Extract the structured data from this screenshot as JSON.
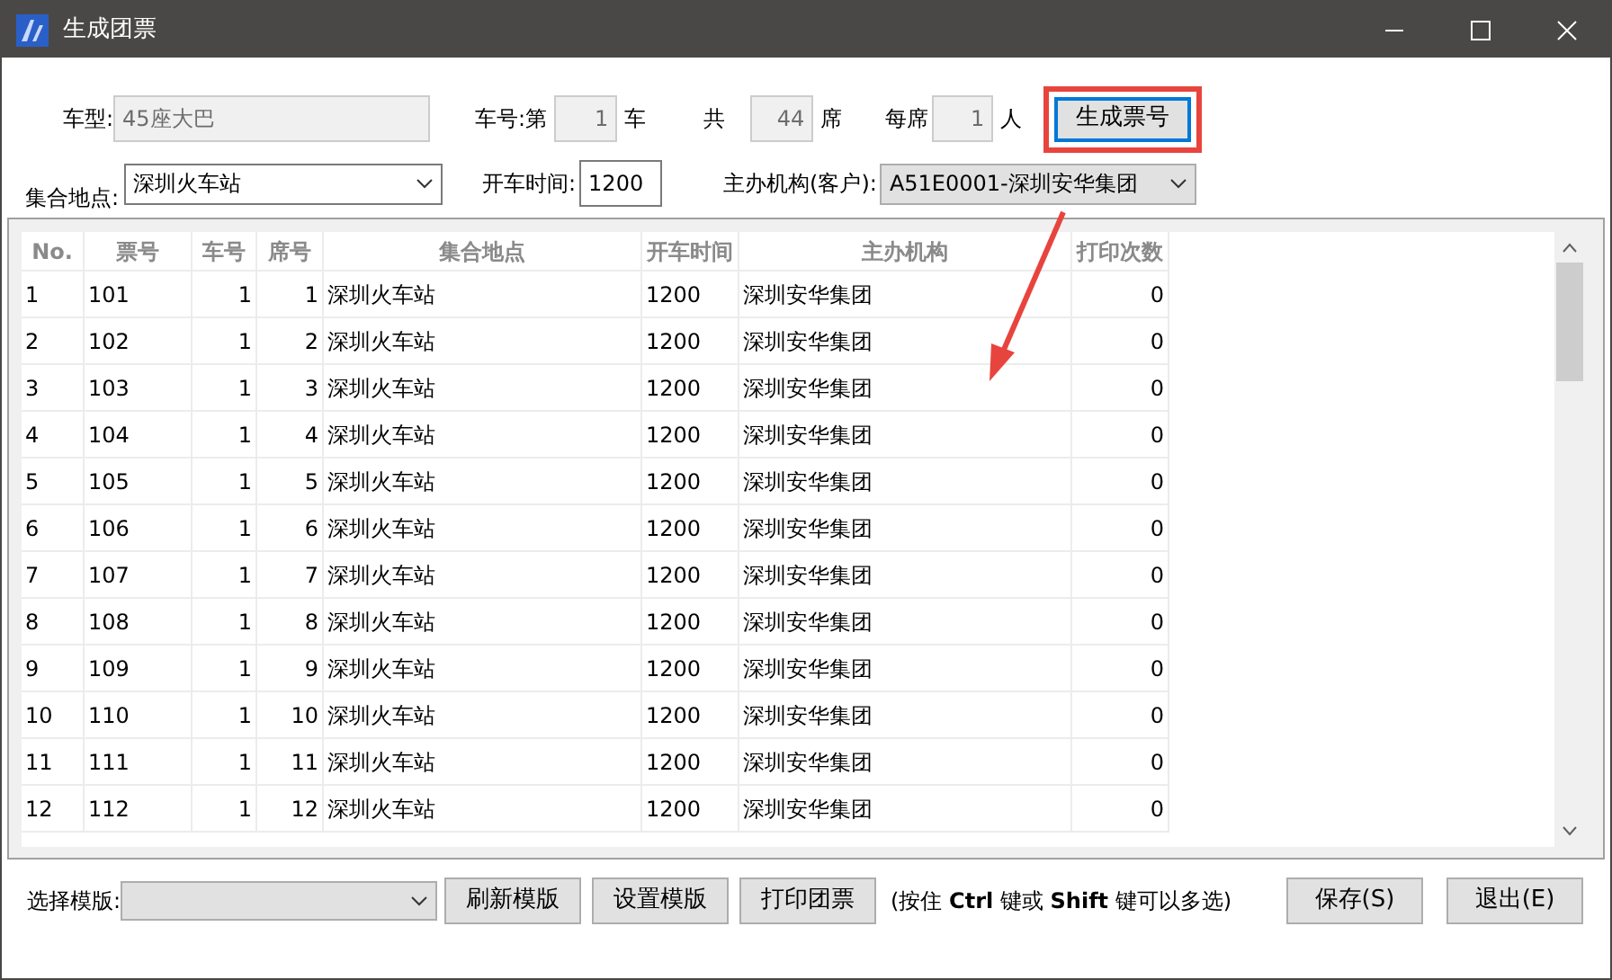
{
  "window": {
    "title": "生成团票"
  },
  "form": {
    "vehicle_type": {
      "label": "车型:",
      "value": "45座大巴"
    },
    "vehicle_no": {
      "label": "车号:第",
      "value": "1",
      "unit": "车"
    },
    "total": {
      "label": "共",
      "value": "44",
      "unit": "席"
    },
    "per_seat": {
      "label": "每席",
      "value": "1",
      "unit": "人"
    },
    "generate_button": "生成票号",
    "meeting_place": {
      "label": "集合地点:",
      "value": "深圳火车站"
    },
    "departure_time": {
      "label": "开车时间:",
      "value": "1200"
    },
    "organizer": {
      "label": "主办机构(客户):",
      "value": "A51E0001-深圳安华集团"
    }
  },
  "table": {
    "columns": [
      "No.",
      "票号",
      "车号",
      "席号",
      "集合地点",
      "开车时间",
      "主办机构",
      "打印次数"
    ],
    "rows": [
      [
        "1",
        "101",
        "1",
        "1",
        "深圳火车站",
        "1200",
        "深圳安华集团",
        "0"
      ],
      [
        "2",
        "102",
        "1",
        "2",
        "深圳火车站",
        "1200",
        "深圳安华集团",
        "0"
      ],
      [
        "3",
        "103",
        "1",
        "3",
        "深圳火车站",
        "1200",
        "深圳安华集团",
        "0"
      ],
      [
        "4",
        "104",
        "1",
        "4",
        "深圳火车站",
        "1200",
        "深圳安华集团",
        "0"
      ],
      [
        "5",
        "105",
        "1",
        "5",
        "深圳火车站",
        "1200",
        "深圳安华集团",
        "0"
      ],
      [
        "6",
        "106",
        "1",
        "6",
        "深圳火车站",
        "1200",
        "深圳安华集团",
        "0"
      ],
      [
        "7",
        "107",
        "1",
        "7",
        "深圳火车站",
        "1200",
        "深圳安华集团",
        "0"
      ],
      [
        "8",
        "108",
        "1",
        "8",
        "深圳火车站",
        "1200",
        "深圳安华集团",
        "0"
      ],
      [
        "9",
        "109",
        "1",
        "9",
        "深圳火车站",
        "1200",
        "深圳安华集团",
        "0"
      ],
      [
        "10",
        "110",
        "1",
        "10",
        "深圳火车站",
        "1200",
        "深圳安华集团",
        "0"
      ],
      [
        "11",
        "111",
        "1",
        "11",
        "深圳火车站",
        "1200",
        "深圳安华集团",
        "0"
      ],
      [
        "12",
        "112",
        "1",
        "12",
        "深圳火车站",
        "1200",
        "深圳安华集团",
        "0"
      ]
    ]
  },
  "footer": {
    "template_label": "选择模版:",
    "buttons": [
      "刷新模版",
      "设置模版",
      "打印团票"
    ],
    "hint": "(按住 **Ctrl** 键或 **Shift** 键可以多选)",
    "save": "保存(S)",
    "exit": "退出(E)"
  }
}
